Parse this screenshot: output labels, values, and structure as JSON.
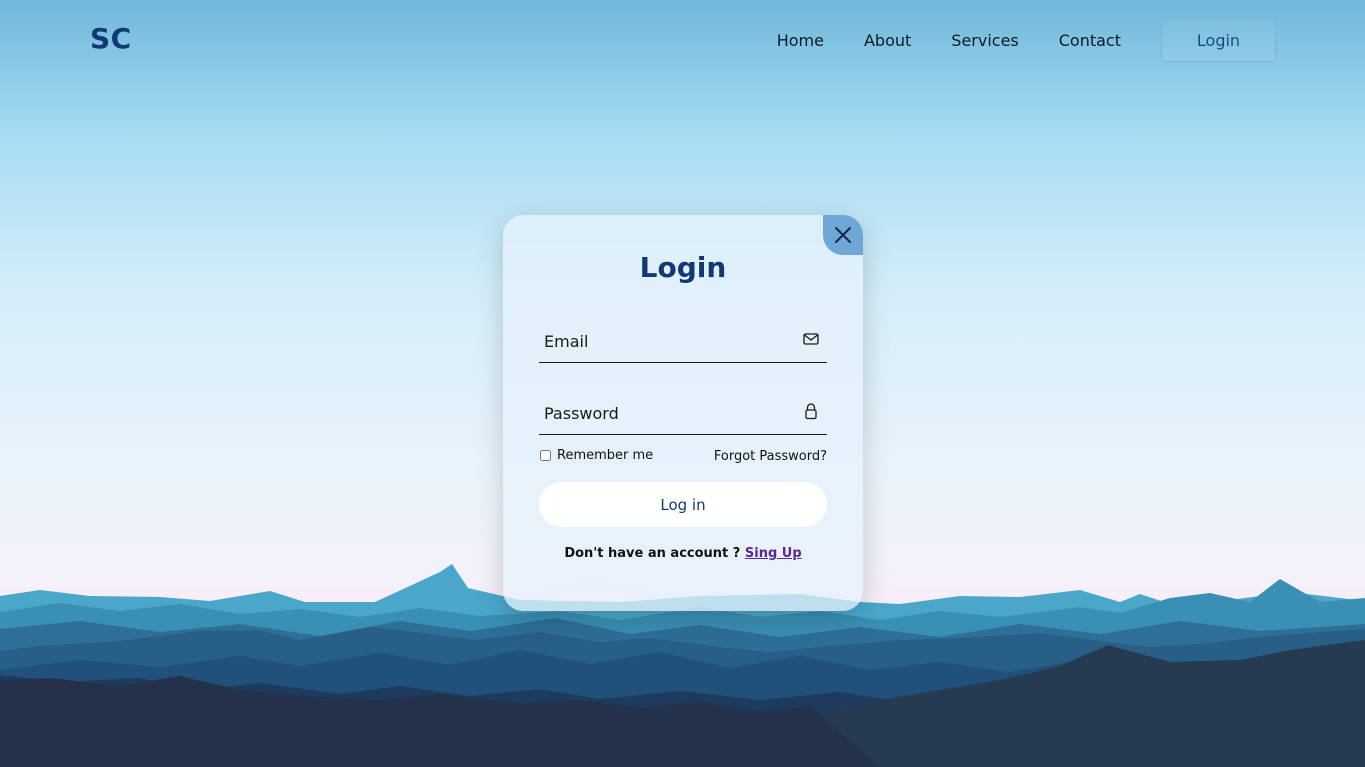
{
  "brand": {
    "logo_text": "SC"
  },
  "nav": {
    "items": [
      {
        "label": "Home"
      },
      {
        "label": "About"
      },
      {
        "label": "Services"
      },
      {
        "label": "Contact"
      }
    ],
    "login_label": "Login"
  },
  "login_form": {
    "title": "Login",
    "email_placeholder": "Email",
    "email_icon": "envelope-icon",
    "password_placeholder": "Password",
    "password_icon": "lock-icon",
    "remember_label": "Remember me",
    "remember_checked": false,
    "forgot_label": "Forgot Password?",
    "submit_label": "Log in",
    "signup_prompt": "Don't have an account ?",
    "signup_link": "Sing Up",
    "close_icon": "close-icon"
  },
  "colors": {
    "brand": "#123a72",
    "close_button": "#6fa7d6",
    "signup_link": "#5b2a91"
  }
}
